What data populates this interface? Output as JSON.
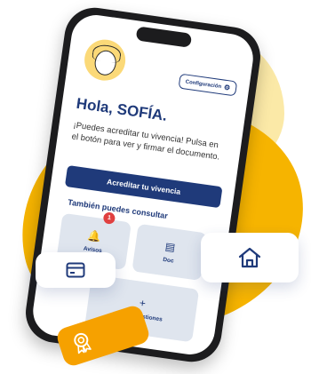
{
  "header": {
    "config_label": "Configuración"
  },
  "greeting": "Hola, SOFÍA.",
  "message": "¡Puedes acreditar tu vivencia! Pulsa en el botón para ver y firmar el documento.",
  "primary_action": "Acreditar tu vivencia",
  "section_title": "También puedes consultar",
  "tiles": [
    {
      "label": "Avisos",
      "icon": "bell-icon",
      "badge": "1"
    },
    {
      "label": "Doc",
      "icon": "document-icon"
    },
    {
      "label": "Otras gestiones",
      "icon": "plus-icon"
    }
  ],
  "floating_cards": {
    "pay": "credit-card-icon",
    "home": "home-icon",
    "award": "award-badge-icon"
  },
  "colors": {
    "accent": "#1f3a7a",
    "yellow": "#f6b400",
    "badge": "#e04040"
  }
}
